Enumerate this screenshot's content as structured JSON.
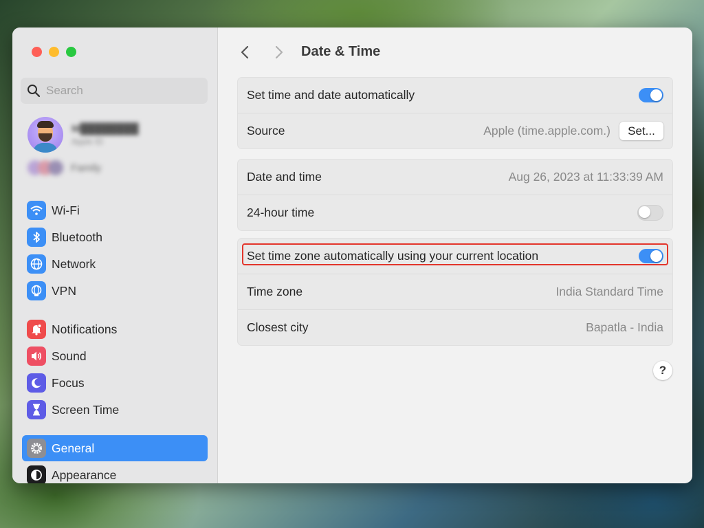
{
  "sidebar": {
    "search_placeholder": "Search",
    "profile": {
      "name": "M████████",
      "subtitle": "Apple ID"
    },
    "family_label": "Family",
    "items": [
      {
        "label": "Wi-Fi",
        "icon": "wifi-icon",
        "color": "#3c8ff6"
      },
      {
        "label": "Bluetooth",
        "icon": "bluetooth-icon",
        "color": "#3c8ff6"
      },
      {
        "label": "Network",
        "icon": "globe-icon",
        "color": "#3c8ff6"
      },
      {
        "label": "VPN",
        "icon": "vpn-globe-icon",
        "color": "#3c8ff6"
      },
      {
        "label": "Notifications",
        "icon": "bell-icon",
        "color": "#ef4b4b"
      },
      {
        "label": "Sound",
        "icon": "speaker-icon",
        "color": "#ee4f63"
      },
      {
        "label": "Focus",
        "icon": "moon-icon",
        "color": "#5e5ce6"
      },
      {
        "label": "Screen Time",
        "icon": "hourglass-icon",
        "color": "#5e5ce6"
      },
      {
        "label": "General",
        "icon": "gear-icon",
        "color": "#8e8e93",
        "active": true
      },
      {
        "label": "Appearance",
        "icon": "appearance-icon",
        "color": "#1c1c1e"
      }
    ]
  },
  "main": {
    "title": "Date & Time",
    "groups": [
      {
        "rows": [
          {
            "label": "Set time and date automatically",
            "toggle": true
          },
          {
            "label": "Source",
            "value": "Apple (time.apple.com.)",
            "button": "Set..."
          }
        ]
      },
      {
        "rows": [
          {
            "label": "Date and time",
            "value": "Aug 26, 2023 at 11:33:39 AM"
          },
          {
            "label": "24-hour time",
            "toggle": false
          }
        ]
      },
      {
        "rows": [
          {
            "label": "Set time zone automatically using your current location",
            "toggle": true,
            "highlighted": true
          },
          {
            "label": "Time zone",
            "value": "India Standard Time"
          },
          {
            "label": "Closest city",
            "value": "Bapatla - India"
          }
        ]
      }
    ],
    "help_label": "?"
  },
  "colors": {
    "accent": "#3c8ff6",
    "highlight": "#e3352b"
  }
}
